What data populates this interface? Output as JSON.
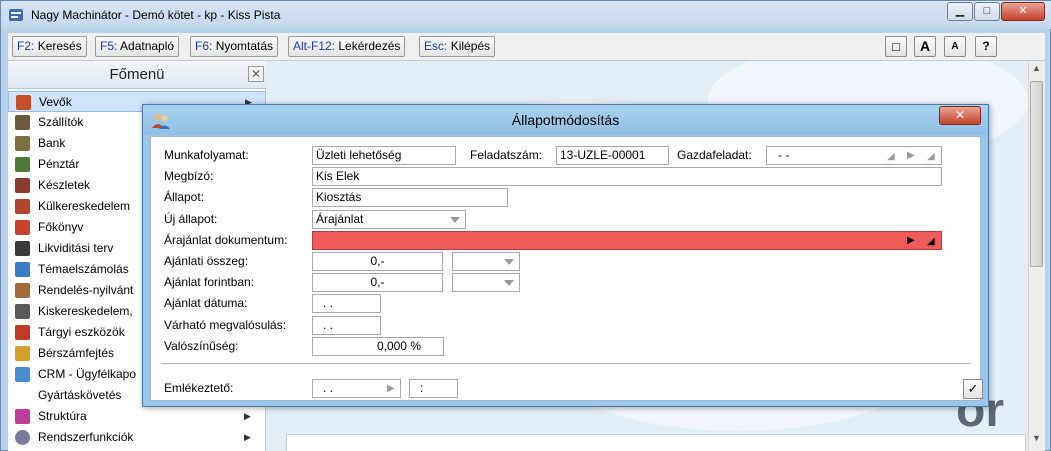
{
  "window": {
    "title": "Nagy Machinátor - Demó kötet - kp - Kiss Pista",
    "minimize_glyph": "▁",
    "maximize_glyph": "□",
    "close_glyph": "✕"
  },
  "toolbar": {
    "buttons": [
      {
        "key": "F2:",
        "label": "Keresés"
      },
      {
        "key": "F5:",
        "label": "Adatnapló"
      },
      {
        "key": "F6:",
        "label": "Nyomtatás"
      },
      {
        "key": "Alt-F12:",
        "label": "Lekérdezés"
      },
      {
        "key": "Esc:",
        "label": "Kilépés"
      }
    ],
    "right_buttons": [
      "□",
      "A",
      "A",
      "?"
    ]
  },
  "sidebar": {
    "title": "Főmenü",
    "close_glyph": "✕",
    "items": [
      {
        "label": "Vevők",
        "icon_color": "#c4502a",
        "has_submenu": true
      },
      {
        "label": "Szállítók",
        "icon_color": "#6b5a3c",
        "has_submenu": false
      },
      {
        "label": "Bank",
        "icon_color": "#7a6f3d",
        "has_submenu": false
      },
      {
        "label": "Pénztár",
        "icon_color": "#4d7a3a",
        "has_submenu": false
      },
      {
        "label": "Készletek",
        "icon_color": "#8a3b2e",
        "has_submenu": false
      },
      {
        "label": "Külkereskedelem",
        "icon_color": "#b0442c",
        "has_submenu": false
      },
      {
        "label": "Főkönyv",
        "icon_color": "#c9432b",
        "has_submenu": false
      },
      {
        "label": "Likviditási terv",
        "icon_color": "#3a3a3a",
        "has_submenu": false
      },
      {
        "label": "Témaelszámolás",
        "icon_color": "#3b7bc4",
        "has_submenu": false
      },
      {
        "label": "Rendelés-nyilvánt",
        "icon_color": "#a06a3a",
        "has_submenu": false
      },
      {
        "label": "Kiskereskedelem,",
        "icon_color": "#5a5a5a",
        "has_submenu": false
      },
      {
        "label": "Tárgyi eszközök",
        "icon_color": "#c03a2a",
        "has_submenu": false
      },
      {
        "label": "Bérszámfejtés",
        "icon_color": "#d4a02a",
        "has_submenu": false
      },
      {
        "label": "CRM - Ügyfélkapo",
        "icon_color": "#4a8bd0",
        "has_submenu": false
      },
      {
        "label": "Gyártáskövetés",
        "icon_color": "",
        "has_submenu": false
      },
      {
        "label": "Struktúra",
        "icon_color": "#c03a9a",
        "has_submenu": true
      },
      {
        "label": "Rendszerfunkciók",
        "icon_color": "#7a7a9a",
        "has_submenu": true
      }
    ]
  },
  "background": {
    "watermark_text": "or"
  },
  "dialog": {
    "title": "Állapotmódosítás",
    "close_glyph": "✕",
    "fields": {
      "munkafolyamat_label": "Munkafolyamat:",
      "munkafolyamat_value": "Üzleti lehetőség",
      "feladatszam_label": "Feladatszám:",
      "feladatszam_value": "13-UZLE-00001",
      "gazdafeladat_label": "Gazdafeladat:",
      "gazdafeladat_value": "-    -",
      "megbizo_label": "Megbízó:",
      "megbizo_value": "Kis Elek",
      "allapot_label": "Állapot:",
      "allapot_value": "Kiosztás",
      "uj_allapot_label": "Új állapot:",
      "uj_allapot_value": "Árajánlat",
      "arajanlat_dok_label": "Árajánlat dokumentum:",
      "arajanlat_dok_value": "",
      "ajanlati_osszeg_label": "Ajánlati összeg:",
      "ajanlati_osszeg_value": "0,-",
      "ajanlat_forintban_label": "Ajánlat forintban:",
      "ajanlat_forintban_value": "0,-",
      "ajanlat_datuma_label": "Ajánlat dátuma:",
      "ajanlat_datuma_value": ".  .",
      "vart_megvalosulas_label": "Várható megvalósulás:",
      "vart_megvalosulas_value": ".  .",
      "valoszinuseg_label": "Valószínűség:",
      "valoszinuseg_value": "0,000 %",
      "emlekezteto_label": "Emlékeztető:",
      "emlekezteto_date": ".  .",
      "emlekezteto_time": ":"
    },
    "ok_glyph": "✓"
  },
  "colors": {
    "required_field": "#ef5b5b",
    "accent": "#1a3ea8"
  }
}
